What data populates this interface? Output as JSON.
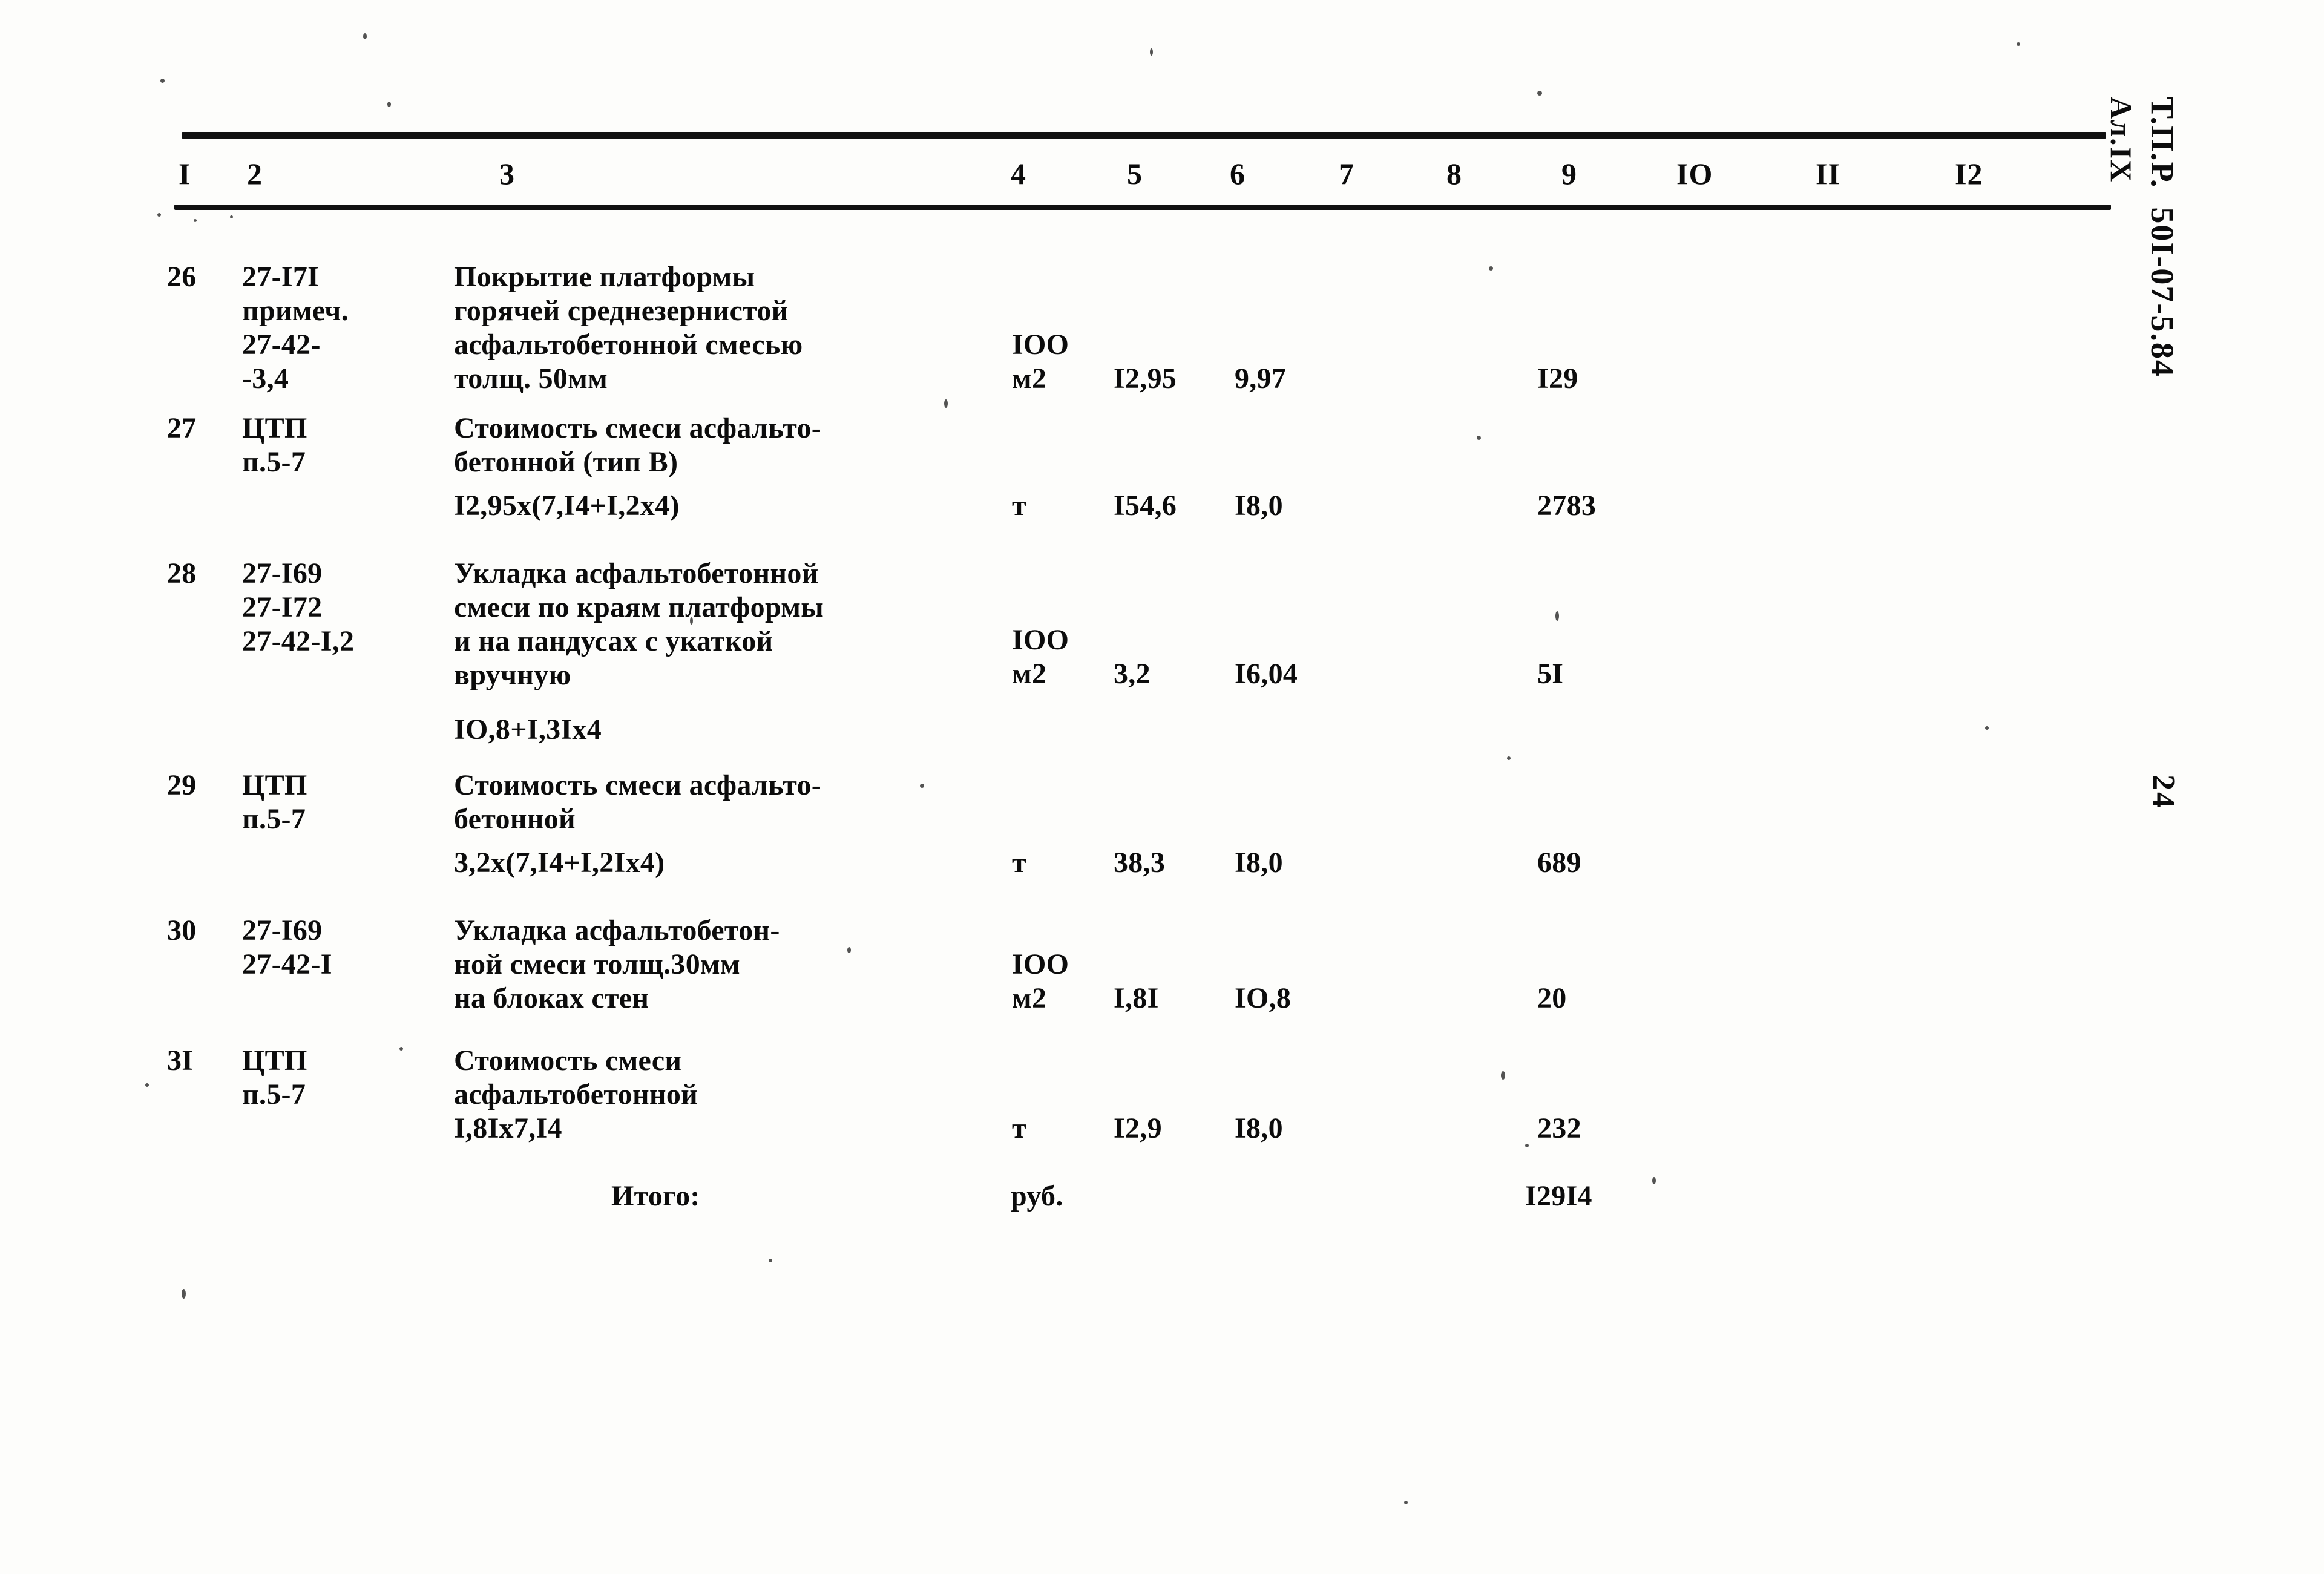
{
  "document": {
    "stamp_main": "Т.П.Р.  50I-07-5.84",
    "stamp_sub": "Ал.IX",
    "page_number": "24"
  },
  "table": {
    "column_headers": [
      "I",
      "2",
      "3",
      "4",
      "5",
      "6",
      "7",
      "8",
      "9",
      "IO",
      "II",
      "I2"
    ],
    "rows": [
      {
        "no": "26",
        "code": "27-I7I\nпримеч.\n27-42-\n-3,4",
        "description": "Покрытие платформы\nгорячей среднезернистой\nасфальтобетонной смесью\nтолщ. 50мм",
        "unit": "IOO\nм2",
        "col5": "I2,95",
        "col6": "9,97",
        "col9": "I29",
        "formula": ""
      },
      {
        "no": "27",
        "code": "ЦТП\nп.5-7",
        "description": "Стоимость смеси асфальто-\nбетонной (тип В)",
        "unit": "т",
        "col5": "I54,6",
        "col6": "I8,0",
        "col9": "2783",
        "formula": "I2,95х(7,I4+I,2х4)"
      },
      {
        "no": "28",
        "code": "27-I69\n27-I72\n27-42-I,2",
        "description": "Укладка асфальтобетонной\nсмеси по краям платформы\nи на пандусах с укаткой\nвручную",
        "unit": "IOO\nм2",
        "col5": "3,2",
        "col6": "I6,04",
        "col9": "5I",
        "formula": "IO,8+I,3Iх4"
      },
      {
        "no": "29",
        "code": "ЦТП\nп.5-7",
        "description": "Стоимость смеси асфальто-\nбетонной",
        "unit": "т",
        "col5": "38,3",
        "col6": "I8,0",
        "col9": "689",
        "formula": "3,2х(7,I4+I,2Iх4)"
      },
      {
        "no": "30",
        "code": "27-I69\n27-42-I",
        "description": "Укладка асфальтобетон-\nной смеси толщ.30мм\nна блоках стен",
        "unit": "IOO\nм2",
        "col5": "I,8I",
        "col6": "IO,8",
        "col9": "20",
        "formula": ""
      },
      {
        "no": "3I",
        "code": "ЦТП\nп.5-7",
        "description": "Стоимость смеси\nасфальтобетонной",
        "unit": "т",
        "col5": "I2,9",
        "col6": "I8,0",
        "col9": "232",
        "formula": "I,8Iх7,I4"
      }
    ],
    "total": {
      "label": "Итого:",
      "unit": "руб.",
      "value": "I29I4"
    }
  }
}
